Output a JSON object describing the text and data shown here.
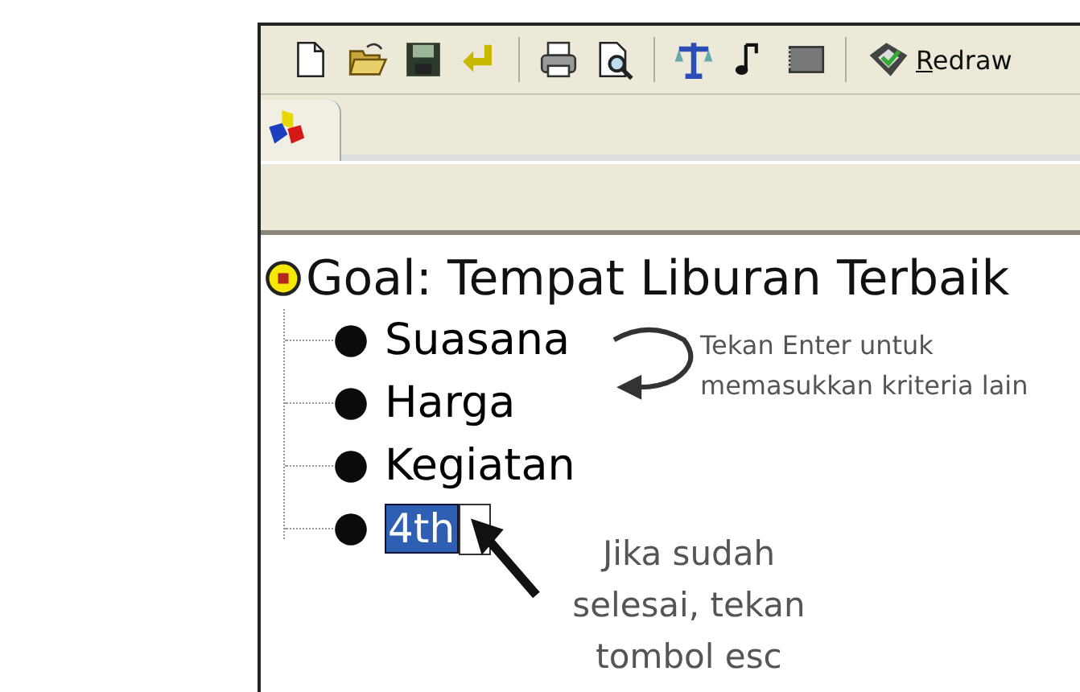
{
  "toolbar": [
    {
      "kind": "new"
    },
    {
      "kind": "open"
    },
    {
      "kind": "save"
    },
    {
      "kind": "undo"
    },
    {
      "kind": "separator"
    },
    {
      "kind": "print"
    },
    {
      "kind": "preview"
    },
    {
      "kind": "separator"
    },
    {
      "kind": "scale"
    },
    {
      "kind": "note"
    },
    {
      "kind": "notebook"
    },
    {
      "kind": "separator"
    },
    {
      "kind": "redraw",
      "label": "Redraw"
    }
  ],
  "tabs": [
    {
      "kind": "blocks",
      "selected": true
    }
  ],
  "tree": {
    "goal": "Goal: Tempat Liburan Terbaik",
    "children": [
      {
        "label": "Suasana",
        "editing": false
      },
      {
        "label": "Harga",
        "editing": false
      },
      {
        "label": "Kegiatan",
        "editing": false
      },
      {
        "label": "4th",
        "editing": true
      }
    ]
  },
  "annotations": [
    {
      "kind": "enter",
      "text": "Tekan Enter untuk memasukkan kriteria lain"
    },
    {
      "kind": "esc",
      "text": "Jika sudah selesai, tekan tombol esc"
    }
  ]
}
